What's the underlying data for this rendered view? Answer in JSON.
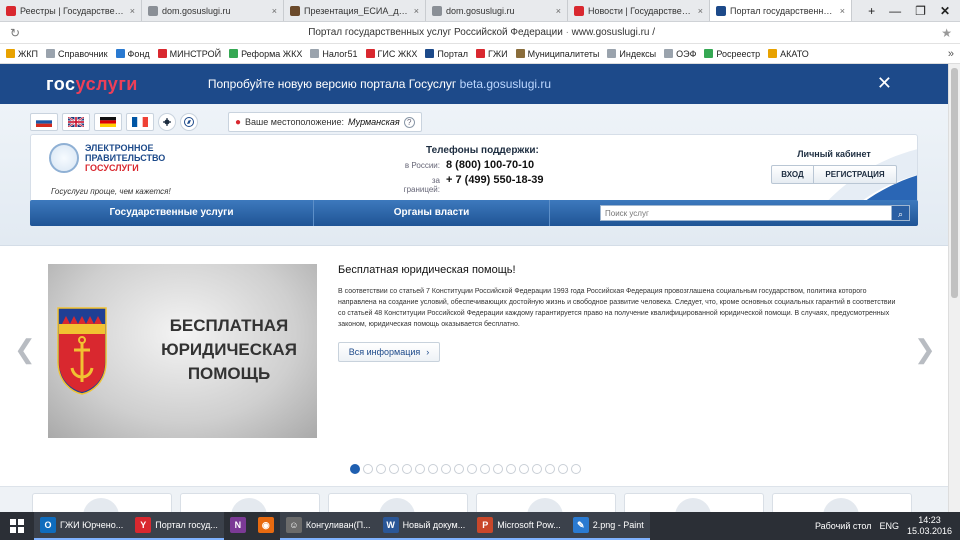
{
  "browser": {
    "tabs": [
      {
        "label": "Реестры | Государственная жи",
        "icon_color": "#d9282f",
        "active": false
      },
      {
        "label": "dom.gosuslugi.ru",
        "icon_color": "#8a8f96",
        "active": false
      },
      {
        "label": "Презентация_ЕСИА_для_докла",
        "icon_color": "#6b4a2b",
        "active": false
      },
      {
        "label": "dom.gosuslugi.ru",
        "icon_color": "#8a8f96",
        "active": false
      },
      {
        "label": "Новости | Государственная жи",
        "icon_color": "#d9282f",
        "active": false
      },
      {
        "label": "Портал государственных у",
        "icon_color": "#1d4a8a",
        "active": true
      }
    ],
    "window_controls": {
      "add": "+",
      "minimize": "—",
      "restore": "❐",
      "close": "✕"
    },
    "address": {
      "reload": "↻",
      "url_title": "Портал государственных услуг Российской Федерации",
      "url_host": "www.gosuslugi.ru",
      "url_tail": "/",
      "star": "★"
    },
    "bookmarks": [
      {
        "label": "ЖКП",
        "icon_color": "#e8a200"
      },
      {
        "label": "Справочник",
        "icon_color": "#9aa3ad"
      },
      {
        "label": "Фонд",
        "icon_color": "#2a7ad1"
      },
      {
        "label": "МИНСТРОЙ",
        "icon_color": "#d9282f"
      },
      {
        "label": "Реформа ЖКХ",
        "icon_color": "#35a853"
      },
      {
        "label": "Налог51",
        "icon_color": "#9aa3ad"
      },
      {
        "label": "ГИС ЖКХ",
        "icon_color": "#d9282f"
      },
      {
        "label": "Портал",
        "icon_color": "#1d4a8a"
      },
      {
        "label": "ГЖИ",
        "icon_color": "#d9282f"
      },
      {
        "label": "Муниципалитеты",
        "icon_color": "#8a6d3b"
      },
      {
        "label": "Индексы",
        "icon_color": "#9aa3ad"
      },
      {
        "label": "ОЭФ",
        "icon_color": "#9aa3ad"
      },
      {
        "label": "Росреестр",
        "icon_color": "#35a853"
      },
      {
        "label": "АКАТО",
        "icon_color": "#e8a200"
      }
    ],
    "bookmarks_more": "»"
  },
  "banner": {
    "brand_pre": "гос",
    "brand_post": "услуги",
    "promo_text": "Попробуйте новую версию портала Госуслуг ",
    "promo_link": "beta.gosuslugi.ru",
    "close": "✕"
  },
  "header": {
    "location_label": "Ваше местоположение:",
    "location_value": "Мурманская",
    "location_help": "?",
    "logo_line1": "ЭЛЕКТРОННОЕ",
    "logo_line2": "ПРАВИТЕЛЬСТВО",
    "logo_line3": "ГОСУСЛУГИ",
    "slogan": "Госуслуги проще, чем кажется!",
    "phones_title": "Телефоны поддержки:",
    "phone_ru_label": "в России:",
    "phone_ru": "8 (800) 100-70-10",
    "phone_abroad_label": "за границей:",
    "phone_abroad": "+ 7 (499) 550-18-39",
    "cabinet_title": "Личный кабинет",
    "login": "ВХОД",
    "register": "РЕГИСТРАЦИЯ"
  },
  "nav": {
    "services": "Государственные услуги",
    "authorities": "Органы власти",
    "search_placeholder": "Поиск услуг",
    "search_icon": "⌕"
  },
  "slide": {
    "caption_line1": "БЕСПЛАТНАЯ",
    "caption_line2": "ЮРИДИЧЕСКАЯ",
    "caption_line3": "ПОМОЩЬ",
    "title": "Бесплатная юридическая помощь!",
    "text": "В соответствии со статьей 7 Конституции Российской Федерации 1993 года Российская Федерация провозглашена социальным государством, политика которого направлена на создание условий, обеспечивающих достойную жизнь и свободное развитие человека. Следует, что, кроме основных социальных гарантий в соответствии со статьей 48 Конституции Российской Федерации каждому гарантируется право на получение квалифицированной юридической помощи. В случаях, предусмотренных законом, юридическая помощь оказывается бесплатно.",
    "more": "Вся информация",
    "more_icon": "›",
    "prev": "❮",
    "next": "❯",
    "dot_count": 18,
    "active_dot": 1
  },
  "taskbar": {
    "tasks": [
      {
        "label": "ГЖИ Юрчено...",
        "icon": "O",
        "color": "#0f6cbd",
        "open": true
      },
      {
        "label": "Портал госуд...",
        "icon": "Y",
        "color": "#d9282f",
        "open": true
      },
      {
        "label": "",
        "icon": "N",
        "color": "#7b3a96",
        "open": false
      },
      {
        "label": "",
        "icon": "◉",
        "color": "#e86a10",
        "open": false
      },
      {
        "label": "Конгуливан(П...",
        "icon": "☺",
        "color": "#6b6b6b",
        "open": true
      },
      {
        "label": "Новый докум...",
        "icon": "W",
        "color": "#2b5797",
        "open": true
      },
      {
        "label": "Microsoft Pow...",
        "icon": "P",
        "color": "#c9472a",
        "open": true
      },
      {
        "label": "2.png - Paint",
        "icon": "✎",
        "color": "#2a7ad1",
        "open": true
      }
    ],
    "desktop": "Рабочий стол",
    "lang": "ENG",
    "time": "14:23",
    "date": "15.03.2016"
  }
}
